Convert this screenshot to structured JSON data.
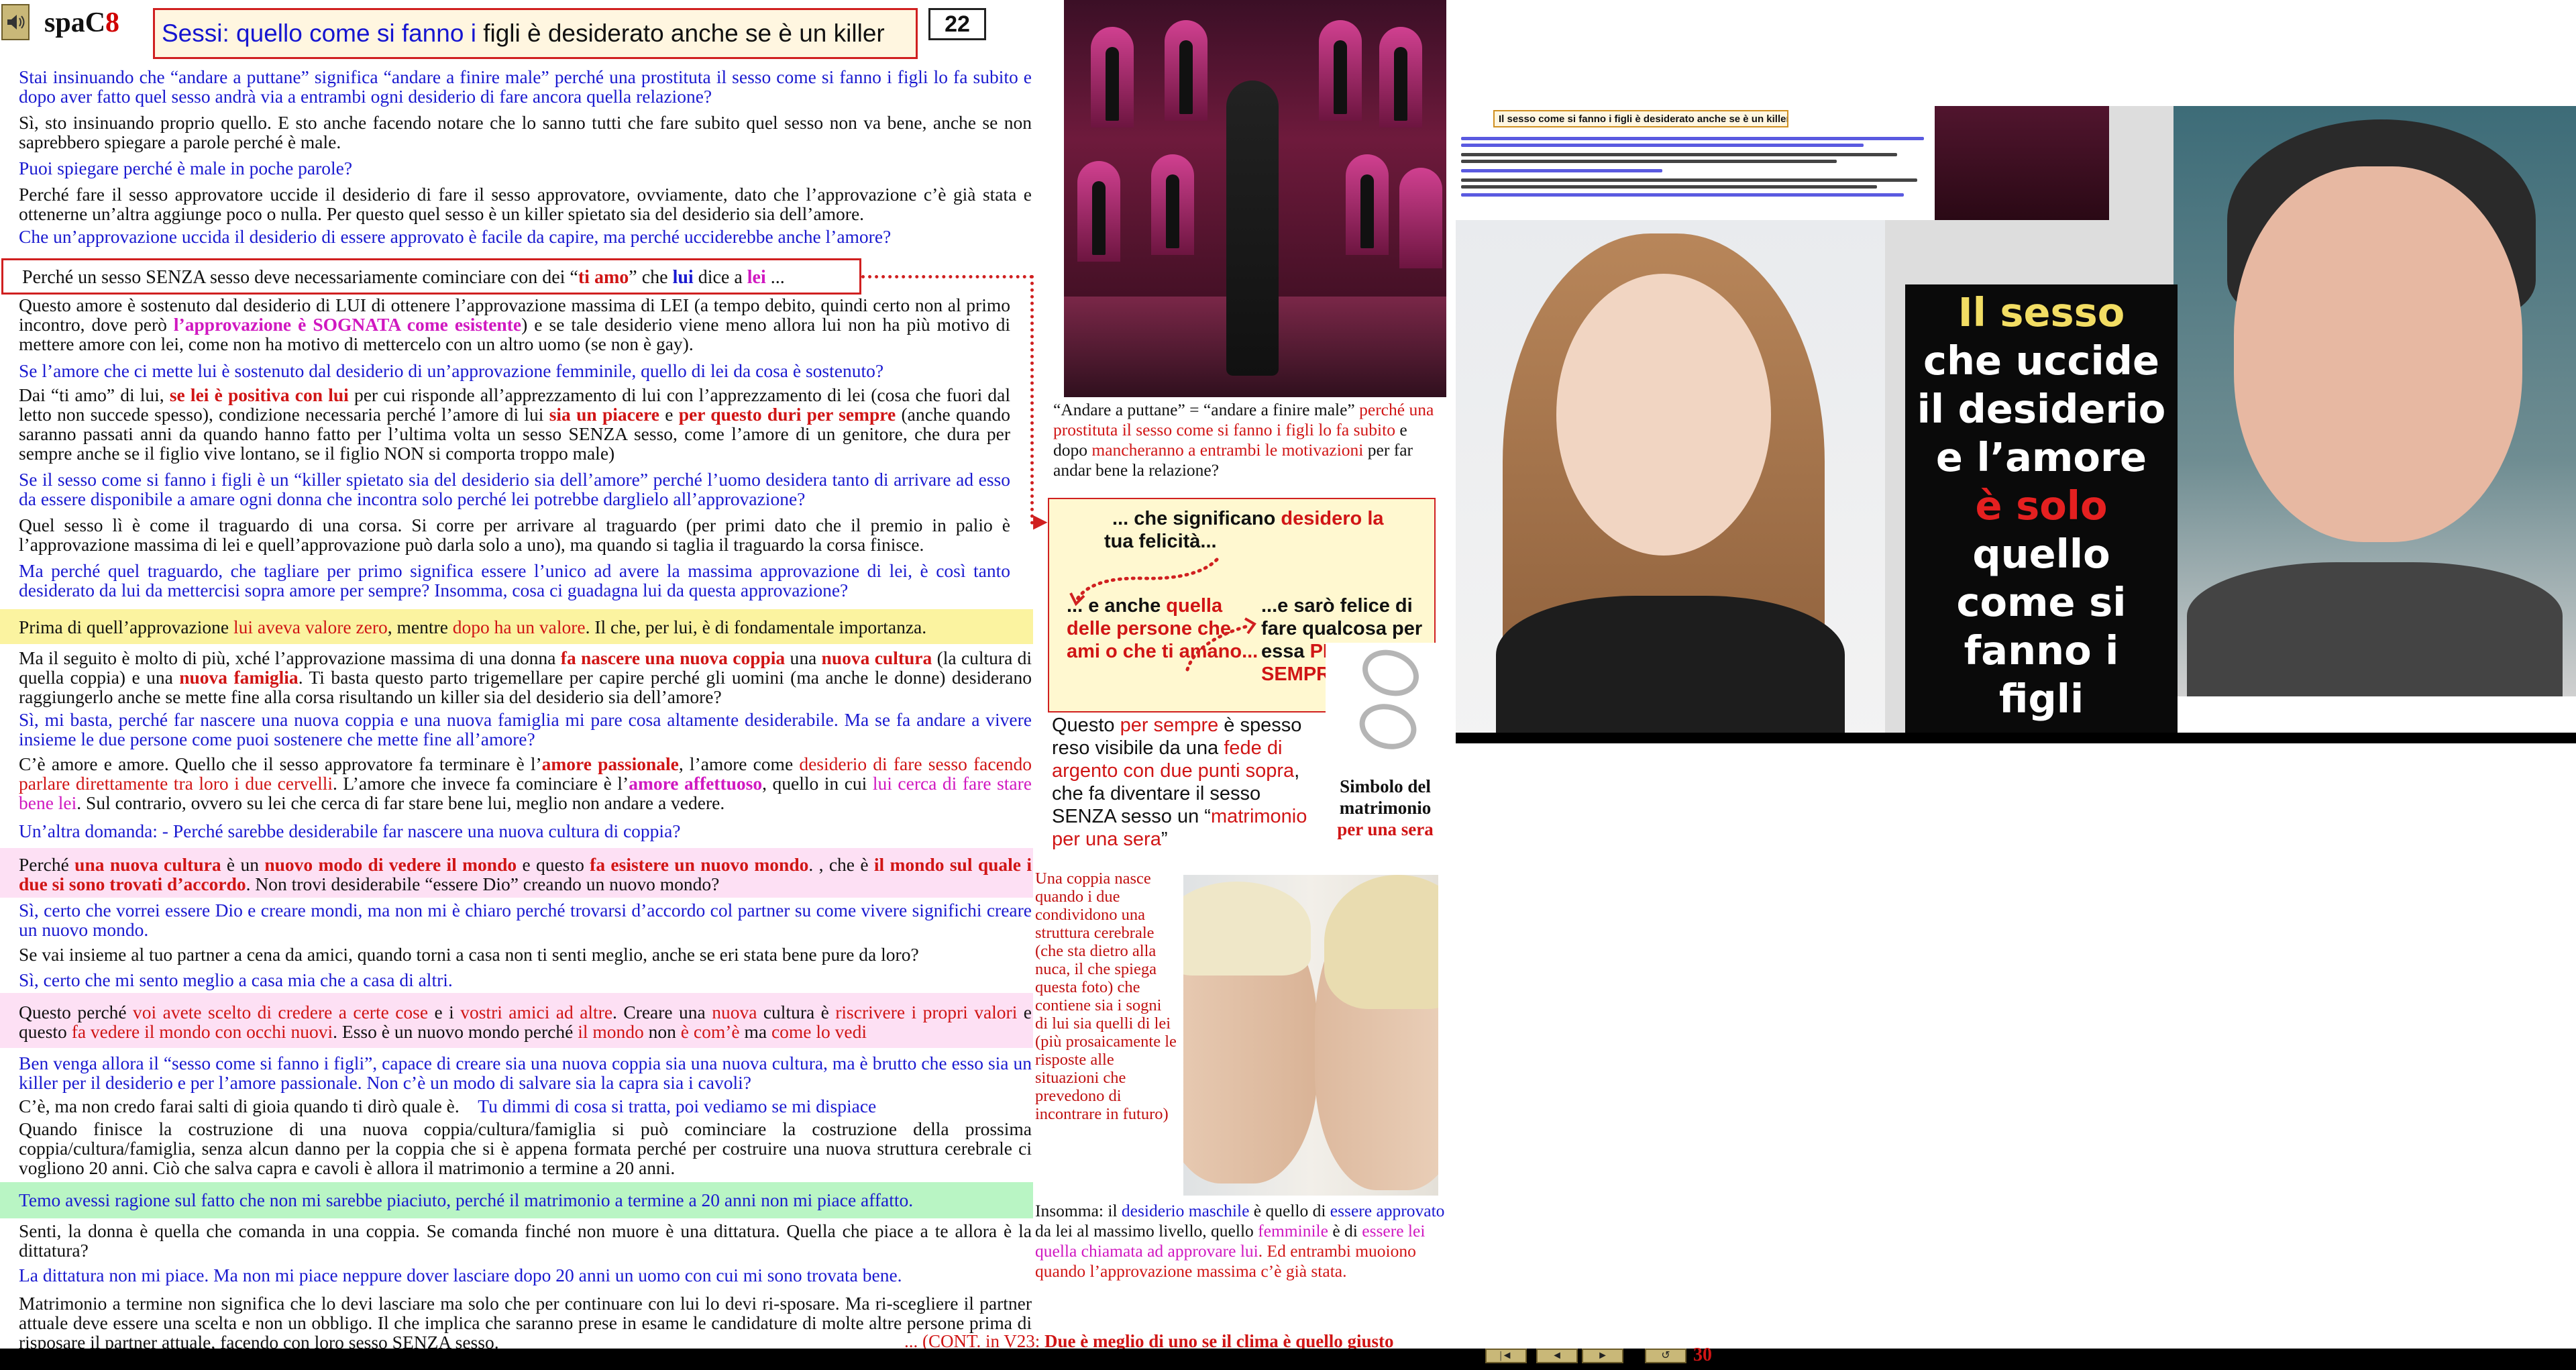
{
  "header": {
    "logo_main": "spaC",
    "logo_num": "8",
    "title_blue": "Sessi: quello come si fanno i",
    "title_rest": " figli è desiderato anche se è un killer",
    "page_number": "22"
  },
  "paragraphs": {
    "p1": "Stai insinuando che “andare a puttane” significa “andare a finire male” perché una prostituta il sesso come si fanno i figli lo fa subito e dopo aver fatto quel sesso andrà via a entrambi ogni desiderio di fare ancora quella relazione?",
    "p2": "Sì, sto insinuando proprio quello. E sto anche facendo notare che lo sanno tutti che fare subito quel sesso non va bene, anche se non saprebbero spiegare a parole perché è male.",
    "p3": "Puoi spiegare perché è male in poche parole?",
    "p4": "Perché fare il sesso approvatore uccide il desiderio di fare il sesso approvatore, ovviamente, dato che l’approvazione c’è già stata e ottenerne un’altra aggiunge poco o nulla. Per questo quel sesso è un killer spietato sia del desiderio sia dell’amore.",
    "p5": "Che un’approvazione uccida il desiderio di essere approvato è facile da capire, ma perché ucciderebbe anche l’amore?",
    "p6_a": "Perché un sesso SENZA sesso deve necessariamente cominciare con dei “",
    "p6_b": "ti amo",
    "p6_c": "” che ",
    "p6_d": "lui",
    "p6_e": " dice a ",
    "p6_f": "lei",
    "p6_g": " ...",
    "p7_a": "Questo amore è sostenuto dal desiderio di LUI di ottenere l’approvazione massima di LEI (a tempo debito, quindi certo non al primo incontro, dove però ",
    "p7_b": "l’approvazione è SOGNATA come esistente",
    "p7_c": ") e se tale desiderio viene meno allora lui non ha più motivo di mettere amore con lei, come non ha motivo di mettercelo con un altro uomo (se non è gay).",
    "p8": "Se l’amore che ci mette lui è sostenuto dal desiderio di un’approvazione femminile, quello di lei da cosa è sostenuto?",
    "p9_a": "Dai “ti amo” di lui, ",
    "p9_b": "se lei è positiva con lui",
    "p9_c": " per cui risponde all’apprezzamento di lui con l’apprezzamento di lei (cosa che fuori dal letto non succede spesso), condizione necessaria perché l’amore di lui ",
    "p9_d": "sia un piacere",
    "p9_e": " e ",
    "p9_f": "per questo duri per sempre",
    "p9_g": " (anche quando saranno passati anni da quando hanno fatto per l’ultima volta un sesso SENZA sesso, come l’amore di un genitore, che dura per sempre anche se il figlio vive lontano, se il figlio NON si comporta troppo male)",
    "p10": "Se il sesso come si fanno i figli è un “killer spietato sia del desiderio sia dell’amore” perché l’uomo desidera tanto di arrivare ad esso da essere disponibile a amare ogni donna che incontra solo perché lei potrebbe darglielo all’approvazione?",
    "p11": "Quel sesso lì è come il traguardo di una corsa. Si corre per arrivare al traguardo (per primi dato che il premio in palio è l’approvazione massima di lei e quell’approvazione può darla solo a uno), ma quando si taglia il traguardo la corsa finisce.",
    "p12": "Ma perché quel traguardo, che tagliare per primo significa essere l’unico ad avere la massima approvazione di lei, è così tanto desiderato da lui da mettercisi sopra amore per sempre? Insomma, cosa ci guadagna lui da questa approvazione?",
    "p13_a": "Prima di quell’approvazione ",
    "p13_b": "lui aveva valore zero",
    "p13_c": ", mentre ",
    "p13_d": "dopo ha un valore",
    "p13_e": ". Il che, per lui, è di fondamentale importanza.",
    "p14_a": "Ma il seguito è molto di più, xché l’approvazione massima di una donna ",
    "p14_b": "fa nascere una nuova coppia",
    "p14_c": " una ",
    "p14_d": "nuova cultura",
    "p14_e": " (la cultura di quella coppia) e una ",
    "p14_f": "nuova famiglia",
    "p14_g": ". Ti basta questo parto trigemellare per capire perché gli uomini (ma anche le donne) desiderano raggiungerlo anche se mette fine alla corsa risultando un killer sia del desiderio sia dell’amore?",
    "p15": "Sì, mi basta, perché far nascere una nuova coppia e una nuova famiglia mi pare cosa altamente desiderabile. Ma se fa andare a vivere insieme le due persone come puoi sostenere che mette fine all’amore?",
    "p16_a": "C’è amore e amore. Quello che il sesso approvatore fa terminare è l’",
    "p16_b": "amore passionale",
    "p16_c": ", l’amore come ",
    "p16_d": "desiderio di fare sesso facendo parlare direttamente tra loro i due cervelli",
    "p16_e": ". L’amore che invece fa cominciare è l’",
    "p16_f": "amore affettuoso",
    "p16_g": ", quello in cui ",
    "p16_h": "lui cerca di fare stare bene lei",
    "p16_i": ". Sul contrario, ovvero su lei che cerca di far stare bene lui, meglio non andare a vedere.",
    "p17": "Un’altra domanda: - Perché sarebbe desiderabile far nascere una nuova cultura di coppia?",
    "p18_a": "Perché ",
    "p18_b": "una nuova cultura",
    "p18_c": " è un ",
    "p18_d": "nuovo modo di vedere il mondo",
    "p18_e": " e questo ",
    "p18_f": "fa esistere un nuovo mondo",
    "p18_g": ". , che è ",
    "p18_h": "il mondo sul quale i due si sono trovati d’accordo",
    "p18_i": ". Non trovi desiderabile “essere Dio” creando un nuovo mondo?",
    "p19": "Sì, certo che vorrei essere Dio e creare mondi, ma non mi è chiaro perché trovarsi d’accordo col partner su come vivere significhi creare un nuovo mondo.",
    "p20": "Se vai insieme al tuo partner a cena da amici, quando torni a casa non ti senti meglio, anche se eri stata bene pure da loro?",
    "p21": "Sì, certo che mi sento meglio a casa mia che a casa di altri.",
    "p22_a": "Questo perché ",
    "p22_b": "voi avete scelto di credere a certe cose",
    "p22_c": " e i ",
    "p22_d": "vostri amici ad altre",
    "p22_e": ". Creare una ",
    "p22_f": "nuova",
    "p22_g": " cultura è ",
    "p22_h": "riscrivere i propri valori",
    "p22_i": " e questo ",
    "p22_j": "fa vedere il mondo con occhi nuovi",
    "p22_k": ". Esso è un nuovo mondo perché ",
    "p22_l": "il mondo",
    "p22_m": " non ",
    "p22_n": "è com’è",
    "p22_o": " ma ",
    "p22_p": "come lo vedi",
    "p23": "Ben venga allora il “sesso come si fanno i figli”, capace di creare sia una nuova coppia sia una nuova cultura, ma è brutto che esso sia un killer per il desiderio e per l’amore passionale. Non c’è un modo di salvare sia la capra sia i cavoli?",
    "p24_a": "C’è, ma non credo farai salti di gioia quando ti dirò quale è.",
    "p24_b": "Tu dimmi di cosa si tratta, poi vediamo se mi dispiace",
    "p25": "Quando finisce la costruzione di una nuova coppia/cultura/famiglia si può cominciare la costruzione della prossima coppia/cultura/famiglia, senza alcun danno per la coppia che si è appena formata perché per costruire una nuova struttura cerebrale ci vogliono 20 anni. Ciò che salva capra e cavoli è allora il matrimonio a termine a 20 anni.",
    "p26": "Temo avessi ragione sul fatto che non mi sarebbe piaciuto, perché il matrimonio a termine a 20 anni non mi piace affatto.",
    "p27": "Senti, la donna è quella che comanda in una coppia. Se comanda finché non muore è una dittatura. Quella che piace a te allora è la dittatura?",
    "p28": "La dittatura non mi piace. Ma non mi piace neppure dover lasciare dopo 20 anni un uomo con cui mi sono trovata bene.",
    "p29": "Matrimonio a termine non significa che lo devi lasciare ma solo che per continuare con lui lo devi ri-sposare. Ma ri-scegliere il partner attuale deve essere una scelta e non un obbligo. Il che implica che saranno prese in esame le candidature di molte altre persone prima di risposare il partner attuale, facendo con loro sesso SENZA sesso.",
    "cont_a": " ... (CONT. in V23: ",
    "cont_b": "Due è meglio di uno se il clima è quello giusto"
  },
  "middle": {
    "cap_top_a": "“Andare a puttane” = “andare a finire male”",
    "cap_top_b": " perché una prostituta il sesso come si fanno i figli lo fa subito",
    "cap_top_c": " e dopo ",
    "cap_top_d": "mancheranno a entrambi le motivazioni",
    "cap_top_e": " per far andar bene la relazione?",
    "yb_1_a": "... che significano ",
    "yb_1_b": "desidero la",
    "yb_1_c": "tua felicità...",
    "yb_2_a": "... e anche ",
    "yb_2_b": "quella",
    "yb_2_c": "delle persone che ami o che ti amano...",
    "yb_3_a": "...e sarò felice di fare qualcosa per essa ",
    "yb_3_b": "PER SEMPRE",
    "rings_caption_a": "Simbolo del matrimonio",
    "rings_caption_b": "per una sera",
    "cap_sempre_a": "Questo ",
    "cap_sempre_b": "per sempre",
    "cap_sempre_c": " è spesso reso visibile da una ",
    "cap_sempre_d": "fede di argento con due punti sopra",
    "cap_sempre_e": ", che fa diventare il sesso SENZA sesso un “",
    "cap_sempre_f": "matrimonio per una sera",
    "cap_sempre_g": "”",
    "cap_coppia": "Una coppia nasce quando i due condividono una struttura cerebrale (che sta dietro alla nuca, il che spiega questa foto) che contiene sia i sogni di lui sia quelli di lei (più prosaicamente le risposte alle situazioni che prevedono di incontrare in futuro)",
    "cap_ins_a": "Insomma: il ",
    "cap_ins_b": "desiderio maschile",
    "cap_ins_c": " è quello di ",
    "cap_ins_d": "essere approvato",
    "cap_ins_e": " da lei al massimo livello, quello ",
    "cap_ins_f": "femminile",
    "cap_ins_g": " è  di ",
    "cap_ins_h": "essere lei quella chiamata ad approvare lui",
    "cap_ins_i": ". Ed entrambi muoiono quando l’approvazione massima c’è già stata."
  },
  "video": {
    "slide_title": "Il sesso come si fanno i figli è desiderato anche se è un killer",
    "big_line1": "Il sesso",
    "big_line2": "che uccide",
    "big_line3": "il desiderio",
    "big_line4": "e l’amore",
    "big_line5": "è solo",
    "big_line6": "quello",
    "big_line7": "come si",
    "big_line8": "fanno i",
    "big_line9": "figli"
  },
  "footer": {
    "page_num": "30",
    "nav_first": "|◄",
    "nav_prev": "◄",
    "nav_next": "►",
    "nav_return": "↺"
  },
  "colors": {
    "question_blue": "#1a1ad0",
    "accent_red": "#d01515",
    "magenta": "#d018c0",
    "highlight_yellow": "#fbf3a0",
    "highlight_pink": "#fde0f4",
    "highlight_green": "#b9f5c4"
  },
  "icons": [
    "speaker-icon",
    "wedding-rings-icon"
  ]
}
